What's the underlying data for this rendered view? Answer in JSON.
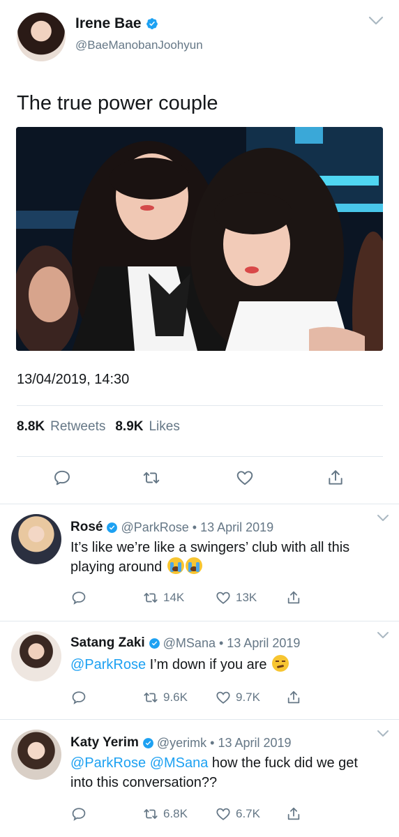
{
  "main_tweet": {
    "name": "Irene Bae",
    "handle": "@BaeManobanJoohyun",
    "text": "The true power couple",
    "timestamp": "13/04/2019, 14:30",
    "retweets_count": "8.8K",
    "retweets_label": "Retweets",
    "likes_count": "8.9K",
    "likes_label": "Likes"
  },
  "replies": [
    {
      "name": "Rosé",
      "handle": "@ParkRose",
      "dot": "•",
      "date": "13 April 2019",
      "text": "It’s like we’re like a swingers’ club with all this playing around",
      "retweets": "14K",
      "likes": "13K"
    },
    {
      "name": "Satang Zaki",
      "handle": "@MSana",
      "dot": "•",
      "date": "13 April 2019",
      "mention1": "@ParkRose",
      "text": " I’m down if you are",
      "retweets": "9.6K",
      "likes": "9.7K"
    },
    {
      "name": "Katy Yerim",
      "handle": "@yerimk",
      "dot": "•",
      "date": "13 April 2019",
      "mention1": "@ParkRose",
      "mention2": "@MSana",
      "text": " how the fuck did we get into this conversation??",
      "retweets": "6.8K",
      "likes": "6.7K"
    }
  ],
  "icons": {
    "verified": "verified-badge-icon",
    "chevron": "chevron-down-icon",
    "reply": "reply-icon",
    "retweet": "retweet-icon",
    "like": "heart-icon",
    "share": "share-icon"
  },
  "colors": {
    "link": "#1da1f2",
    "secondary_text": "#657786",
    "divider": "#e1e8ed",
    "primary_text": "#14171a"
  }
}
